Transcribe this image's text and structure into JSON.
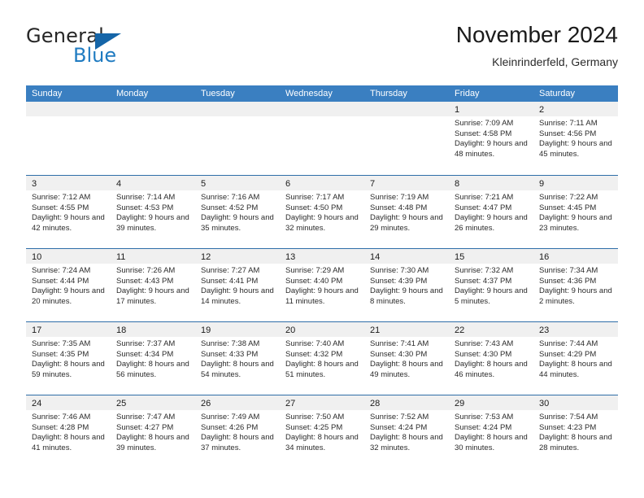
{
  "brand": {
    "name_top": "General",
    "name_bottom": "Blue",
    "accent_color": "#1f7bc1",
    "triangle_color": "#1565a8"
  },
  "header": {
    "title": "November 2024",
    "subtitle": "Kleinrinderfeld, Germany"
  },
  "calendar": {
    "header_bg": "#3a7fc1",
    "weekdays": [
      "Sunday",
      "Monday",
      "Tuesday",
      "Wednesday",
      "Thursday",
      "Friday",
      "Saturday"
    ],
    "weeks": [
      [
        {
          "day": "",
          "empty": true
        },
        {
          "day": "",
          "empty": true
        },
        {
          "day": "",
          "empty": true
        },
        {
          "day": "",
          "empty": true
        },
        {
          "day": "",
          "empty": true
        },
        {
          "day": "1",
          "sunrise": "Sunrise: 7:09 AM",
          "sunset": "Sunset: 4:58 PM",
          "daylight": "Daylight: 9 hours and 48 minutes."
        },
        {
          "day": "2",
          "sunrise": "Sunrise: 7:11 AM",
          "sunset": "Sunset: 4:56 PM",
          "daylight": "Daylight: 9 hours and 45 minutes."
        }
      ],
      [
        {
          "day": "3",
          "sunrise": "Sunrise: 7:12 AM",
          "sunset": "Sunset: 4:55 PM",
          "daylight": "Daylight: 9 hours and 42 minutes."
        },
        {
          "day": "4",
          "sunrise": "Sunrise: 7:14 AM",
          "sunset": "Sunset: 4:53 PM",
          "daylight": "Daylight: 9 hours and 39 minutes."
        },
        {
          "day": "5",
          "sunrise": "Sunrise: 7:16 AM",
          "sunset": "Sunset: 4:52 PM",
          "daylight": "Daylight: 9 hours and 35 minutes."
        },
        {
          "day": "6",
          "sunrise": "Sunrise: 7:17 AM",
          "sunset": "Sunset: 4:50 PM",
          "daylight": "Daylight: 9 hours and 32 minutes."
        },
        {
          "day": "7",
          "sunrise": "Sunrise: 7:19 AM",
          "sunset": "Sunset: 4:48 PM",
          "daylight": "Daylight: 9 hours and 29 minutes."
        },
        {
          "day": "8",
          "sunrise": "Sunrise: 7:21 AM",
          "sunset": "Sunset: 4:47 PM",
          "daylight": "Daylight: 9 hours and 26 minutes."
        },
        {
          "day": "9",
          "sunrise": "Sunrise: 7:22 AM",
          "sunset": "Sunset: 4:45 PM",
          "daylight": "Daylight: 9 hours and 23 minutes."
        }
      ],
      [
        {
          "day": "10",
          "sunrise": "Sunrise: 7:24 AM",
          "sunset": "Sunset: 4:44 PM",
          "daylight": "Daylight: 9 hours and 20 minutes."
        },
        {
          "day": "11",
          "sunrise": "Sunrise: 7:26 AM",
          "sunset": "Sunset: 4:43 PM",
          "daylight": "Daylight: 9 hours and 17 minutes."
        },
        {
          "day": "12",
          "sunrise": "Sunrise: 7:27 AM",
          "sunset": "Sunset: 4:41 PM",
          "daylight": "Daylight: 9 hours and 14 minutes."
        },
        {
          "day": "13",
          "sunrise": "Sunrise: 7:29 AM",
          "sunset": "Sunset: 4:40 PM",
          "daylight": "Daylight: 9 hours and 11 minutes."
        },
        {
          "day": "14",
          "sunrise": "Sunrise: 7:30 AM",
          "sunset": "Sunset: 4:39 PM",
          "daylight": "Daylight: 9 hours and 8 minutes."
        },
        {
          "day": "15",
          "sunrise": "Sunrise: 7:32 AM",
          "sunset": "Sunset: 4:37 PM",
          "daylight": "Daylight: 9 hours and 5 minutes."
        },
        {
          "day": "16",
          "sunrise": "Sunrise: 7:34 AM",
          "sunset": "Sunset: 4:36 PM",
          "daylight": "Daylight: 9 hours and 2 minutes."
        }
      ],
      [
        {
          "day": "17",
          "sunrise": "Sunrise: 7:35 AM",
          "sunset": "Sunset: 4:35 PM",
          "daylight": "Daylight: 8 hours and 59 minutes."
        },
        {
          "day": "18",
          "sunrise": "Sunrise: 7:37 AM",
          "sunset": "Sunset: 4:34 PM",
          "daylight": "Daylight: 8 hours and 56 minutes."
        },
        {
          "day": "19",
          "sunrise": "Sunrise: 7:38 AM",
          "sunset": "Sunset: 4:33 PM",
          "daylight": "Daylight: 8 hours and 54 minutes."
        },
        {
          "day": "20",
          "sunrise": "Sunrise: 7:40 AM",
          "sunset": "Sunset: 4:32 PM",
          "daylight": "Daylight: 8 hours and 51 minutes."
        },
        {
          "day": "21",
          "sunrise": "Sunrise: 7:41 AM",
          "sunset": "Sunset: 4:30 PM",
          "daylight": "Daylight: 8 hours and 49 minutes."
        },
        {
          "day": "22",
          "sunrise": "Sunrise: 7:43 AM",
          "sunset": "Sunset: 4:30 PM",
          "daylight": "Daylight: 8 hours and 46 minutes."
        },
        {
          "day": "23",
          "sunrise": "Sunrise: 7:44 AM",
          "sunset": "Sunset: 4:29 PM",
          "daylight": "Daylight: 8 hours and 44 minutes."
        }
      ],
      [
        {
          "day": "24",
          "sunrise": "Sunrise: 7:46 AM",
          "sunset": "Sunset: 4:28 PM",
          "daylight": "Daylight: 8 hours and 41 minutes."
        },
        {
          "day": "25",
          "sunrise": "Sunrise: 7:47 AM",
          "sunset": "Sunset: 4:27 PM",
          "daylight": "Daylight: 8 hours and 39 minutes."
        },
        {
          "day": "26",
          "sunrise": "Sunrise: 7:49 AM",
          "sunset": "Sunset: 4:26 PM",
          "daylight": "Daylight: 8 hours and 37 minutes."
        },
        {
          "day": "27",
          "sunrise": "Sunrise: 7:50 AM",
          "sunset": "Sunset: 4:25 PM",
          "daylight": "Daylight: 8 hours and 34 minutes."
        },
        {
          "day": "28",
          "sunrise": "Sunrise: 7:52 AM",
          "sunset": "Sunset: 4:24 PM",
          "daylight": "Daylight: 8 hours and 32 minutes."
        },
        {
          "day": "29",
          "sunrise": "Sunrise: 7:53 AM",
          "sunset": "Sunset: 4:24 PM",
          "daylight": "Daylight: 8 hours and 30 minutes."
        },
        {
          "day": "30",
          "sunrise": "Sunrise: 7:54 AM",
          "sunset": "Sunset: 4:23 PM",
          "daylight": "Daylight: 8 hours and 28 minutes."
        }
      ]
    ]
  }
}
